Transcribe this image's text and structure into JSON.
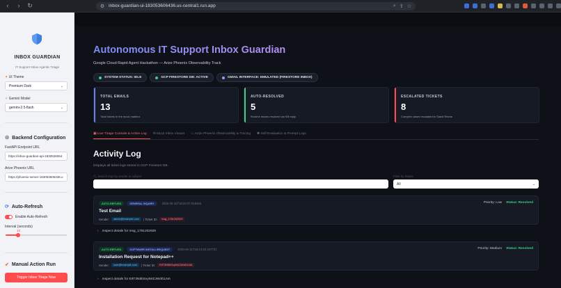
{
  "browser": {
    "url": "inbox-guardian-ui-183053606436.us-central1.run.app"
  },
  "sidebar": {
    "brand": "INBOX GUARDIAN",
    "brand_sub": "IT Support Inbox Agentic Triage",
    "ui_theme_label": "UI Theme",
    "ui_theme_value": "Premium Dark",
    "gemini_model_label": "Gemini Model",
    "gemini_model_value": "gemini-2.5-flash",
    "backend_heading": "Backend Configuration",
    "fastapi_label": "FastAPI Endpoint URL",
    "fastapi_value": "https://inbox-guardian-api-1830536064",
    "phoenix_label": "Arize Phoenix URL",
    "phoenix_value": "https://phoenix-server-183053606436.u",
    "autorefresh_heading": "Auto-Refresh",
    "enable_autorefresh_label": "Enable Auto-Refresh",
    "interval_label": "Interval (seconds)",
    "interval_value": "10",
    "interval_fraction": 0.2,
    "manual_heading": "Manual Action Run",
    "trigger_button": "Trigger Inbox Triage Now"
  },
  "main": {
    "title": "Autonomous IT Support Inbox Guardian",
    "subtitle": "Google Cloud Rapid Agent Hackathon — Arize Phoenix Observability Track",
    "pills": [
      {
        "label": "SYSTEM STATUS: IDLE",
        "color": "#3fd08a"
      },
      {
        "label": "GCP FIRESTORE DB: ACTIVE",
        "color": "#3fd08a"
      },
      {
        "label": "GMAIL INTERFACE: EMULATED (FIRESTORE INBOX)",
        "color": "#8aa3ff"
      }
    ],
    "cards": [
      {
        "title": "TOTAL EMAILS",
        "value": "13",
        "desc": "Total tickets in the mock mailbox",
        "color": "#6f7df2"
      },
      {
        "title": "AUTO-RESOLVED",
        "value": "5",
        "desc": "Routine issues resolved via KB reply",
        "color": "#3fd08a"
      },
      {
        "title": "ESCALATED TICKETS",
        "value": "8",
        "desc": "Complex cases escalated to Slack/Teams",
        "color": "#ff4b4b"
      }
    ],
    "tabs": [
      "Live Triage Console & Action Log",
      "Mock Inbox Viewer",
      "Arize Phoenix Observability & Tracing",
      "Self-Evaluation & Prompt Logs"
    ],
    "activity_title": "Activity Log",
    "activity_caption": "Displays all ticket logs stored in GCP Firestore DB.",
    "search_label": "Search logs by sender or subject",
    "status_filter_label": "Filter by Status",
    "status_filter_value": "All",
    "tickets": [
      {
        "tag1": "AUTO-REPLIED",
        "tag2": "GENERAL INQUIRY",
        "timestamp": "2026-06-11T18:20:37.918446",
        "priority": "Priority: Low",
        "status": "Status: Resolved",
        "title": "Test Email",
        "sender_label": "Sender:",
        "sender_value": "admin@example.com",
        "ticket_label": "| Ticket ID:",
        "ticket_value": "msg_1781202929",
        "expander": "Inspect details for msg_1781202929"
      },
      {
        "tag1": "AUTO-REPLIED",
        "tag2": "SOFTWARE INSTALL/REQUEST",
        "timestamp": "2026-06-11T18:14:22.247731",
        "priority": "Priority: Medium",
        "status": "Status: Resolved",
        "title": "Installation Request for Notepad++",
        "sender_label": "Sender:",
        "sender_value": "user@example.com",
        "ticket_label": "| Ticket ID:",
        "ticket_value": "E9T3N5bSxyMrZJWdGLNA",
        "expander": "Inspect details for E9T3N5bSxyMrZJWdGLNA"
      }
    ]
  }
}
